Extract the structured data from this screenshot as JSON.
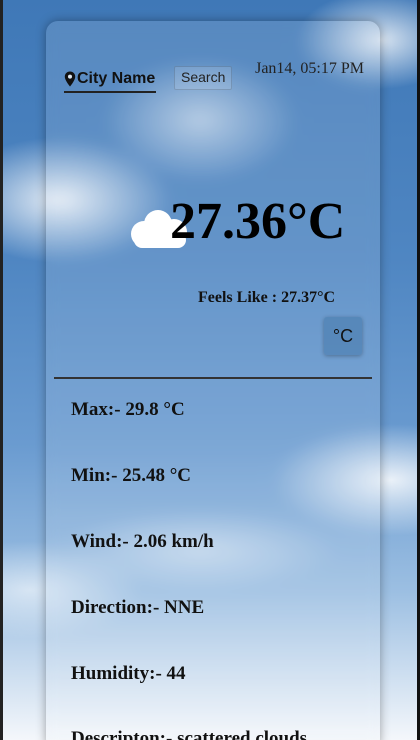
{
  "search": {
    "placeholder": "City Name",
    "button_label": "Search"
  },
  "header": {
    "datetime": "Jan14, 05:17 PM"
  },
  "weather": {
    "icon": "cloud-icon",
    "temperature": "27.36°C",
    "feels_like_label": "Feels Like :",
    "feels_like_value": "27.37°C",
    "unit_toggle_label": "°C"
  },
  "details": [
    {
      "label": "Max:-",
      "value": "29.8 °C"
    },
    {
      "label": "Min:-",
      "value": "25.48 °C"
    },
    {
      "label": "Wind:-",
      "value": "2.06 km/h"
    },
    {
      "label": "Direction:-",
      "value": "NNE"
    },
    {
      "label": "Humidity:-",
      "value": "44"
    },
    {
      "label": "Descripton:-",
      "value": "scattered clouds"
    }
  ]
}
